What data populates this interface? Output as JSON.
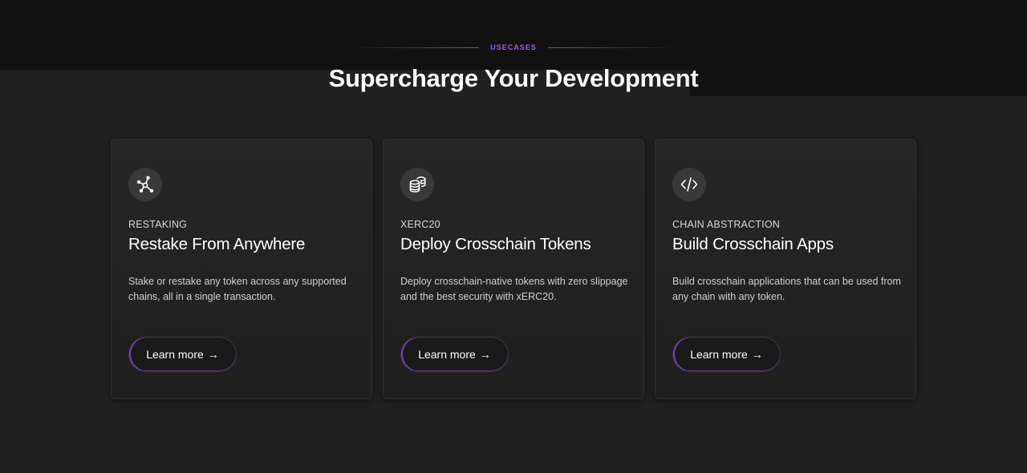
{
  "section": {
    "eyebrow": "USECASES",
    "headline": "Supercharge Your Development"
  },
  "cards": [
    {
      "icon": "network-hub-icon",
      "kicker": "RESTAKING",
      "title": "Restake From Anywhere",
      "description": "Stake or restake any token across any supported chains, all in a single transaction.",
      "button_label": "Learn more",
      "button_arrow": "→"
    },
    {
      "icon": "coin-stack-icon",
      "kicker": "XERC20",
      "title": "Deploy Crosschain Tokens",
      "description": "Deploy crosschain-native tokens with zero slippage and the best security with xERC20.",
      "button_label": "Learn more",
      "button_arrow": "→"
    },
    {
      "icon": "code-icon",
      "kicker": "CHAIN ABSTRACTION",
      "title": "Build Crosschain Apps",
      "description": "Build crosschain applications that can be used from any chain with any token.",
      "button_label": "Learn more",
      "button_arrow": "→"
    }
  ],
  "colors": {
    "accent": "#a45ce0",
    "background": "#202021",
    "card": "#252526"
  }
}
